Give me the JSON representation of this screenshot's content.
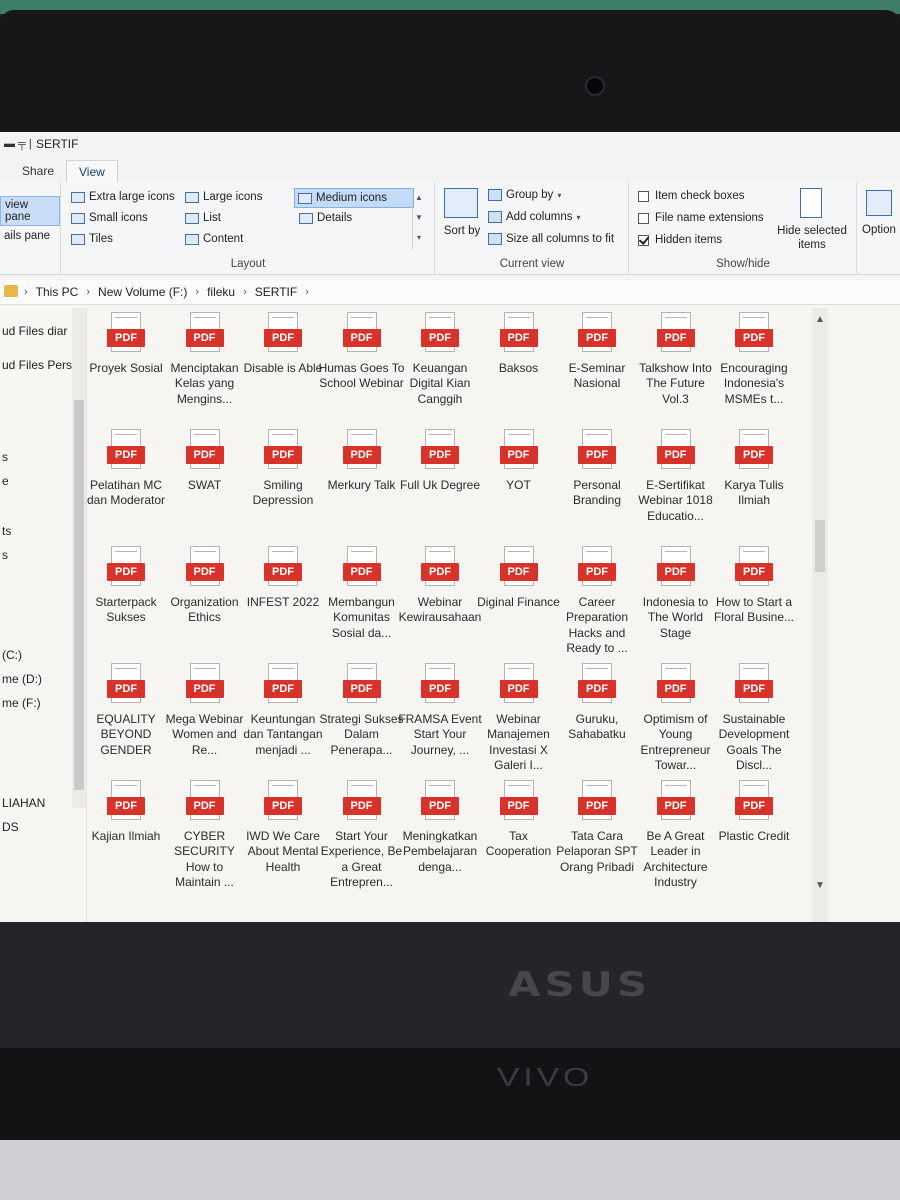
{
  "window": {
    "title": "SERTIF"
  },
  "tabs": [
    "Share",
    "View"
  ],
  "ribbon": {
    "panes": {
      "preview": "view pane",
      "details": "ails pane"
    },
    "layout": {
      "items": [
        "Extra large icons",
        "Large icons",
        "Medium icons",
        "Small icons",
        "List",
        "Details",
        "Tiles",
        "Content"
      ],
      "selected": "Medium icons",
      "group_label": "Layout"
    },
    "current_view": {
      "sort_label": "Sort by",
      "group_by": "Group by",
      "add_columns": "Add columns",
      "size_columns": "Size all columns to fit",
      "group_label": "Current view"
    },
    "show_hide": {
      "item_check_boxes": "Item check boxes",
      "file_name_extensions": "File name extensions",
      "hidden_items": "Hidden items",
      "hidden_items_checked": true,
      "hide_selected": "Hide selected items",
      "group_label": "Show/hide"
    },
    "options": "Option"
  },
  "breadcrumb": [
    "This PC",
    "New Volume (F:)",
    "fileku",
    "SERTIF"
  ],
  "nav_items": [
    "ud Files  diar",
    "ud Files Pers",
    "s",
    "e",
    "ts",
    "s",
    "(C:)",
    "me (D:)",
    "me (F:)",
    "LIAHAN",
    "DS"
  ],
  "files": [
    "Proyek Sosial",
    "Menciptakan Kelas yang Mengins...",
    "Disable is Able",
    "Humas Goes To School Webinar",
    "Keuangan Digital Kian Canggih",
    "Baksos",
    "E-Seminar Nasional",
    "Talkshow Into The Future Vol.3",
    "Encouraging Indonesia's MSMEs t...",
    "Pelatihan MC dan Moderator",
    "SWAT",
    "Smiling Depression",
    "Merkury Talk",
    "Full Uk Degree",
    "YOT",
    "Personal Branding",
    "E-Sertifikat Webinar 1018 Educatio...",
    "Karya Tulis Ilmiah",
    "Starterpack Sukses",
    "Organization Ethics",
    "INFEST 2022",
    "Membangun Komunitas Sosial da...",
    "Webinar Kewirausahaan",
    "Diginal Finance",
    "Career Preparation Hacks and Ready to ...",
    "Indonesia to The World Stage",
    "How to Start a Floral Busine...",
    "EQUALITY BEYOND GENDER",
    "Mega Webinar Women and Re...",
    "Keuntungan dan Tantangan menjadi ...",
    "Strategi Sukses Dalam Penerapa...",
    "FRAMSA Event Start Your Journey, ...",
    "Webinar Manajemen Investasi X Galeri I...",
    "Guruku, Sahabatku",
    "Optimism of Young Entrepreneur Towar...",
    "Sustainable Development Goals The Discl...",
    "Kajian Ilmiah",
    "CYBER SECURITY How to Maintain ...",
    "IWD We Care About Mental Health",
    "Start Your Experience, Be a Great Entrepren...",
    "Meningkatkan Pembelajaran dengа...",
    "Tax Cooperation",
    "Tata Cara Pelaporan SPT Orang Pribadi",
    "Be A Great Leader in Architecture Industry",
    "Plastic Credit"
  ],
  "pdf_badge": "PDF",
  "laptop": {
    "brand": "ASUS",
    "model": "VIVO"
  }
}
